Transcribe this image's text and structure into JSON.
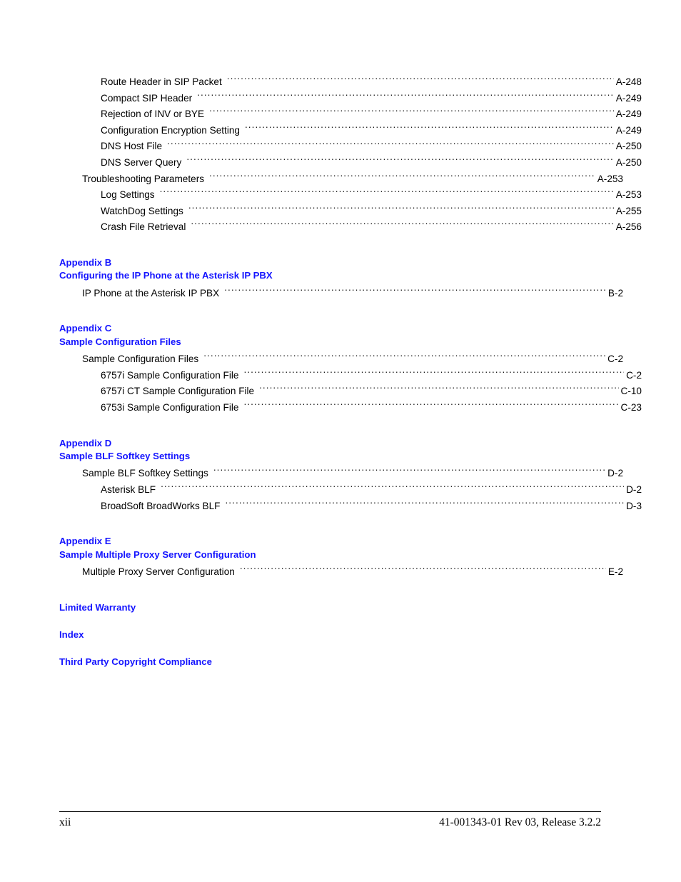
{
  "document": {
    "type": "table-of-contents",
    "heading_color": "#1414ff",
    "text_color": "#000000"
  },
  "toc": {
    "top_entries": [
      {
        "title": "Route Header in SIP Packet",
        "page": "A-248",
        "level": 2
      },
      {
        "title": "Compact SIP Header",
        "page": "A-249",
        "level": 2
      },
      {
        "title": "Rejection of INV or BYE",
        "page": "A-249",
        "level": 2
      },
      {
        "title": "Configuration Encryption Setting",
        "page": "A-249",
        "level": 2
      },
      {
        "title": "DNS Host File",
        "page": "A-250",
        "level": 2
      },
      {
        "title": "DNS Server Query",
        "page": "A-250",
        "level": 2
      },
      {
        "title": "Troubleshooting Parameters",
        "page": "A-253",
        "level": 1
      },
      {
        "title": "Log Settings",
        "page": "A-253",
        "level": 2
      },
      {
        "title": "WatchDog Settings",
        "page": "A-255",
        "level": 2
      },
      {
        "title": "Crash File Retrieval",
        "page": "A-256",
        "level": 2
      }
    ],
    "appendices": [
      {
        "label": "Appendix B",
        "title": "Configuring the IP Phone at the Asterisk IP PBX",
        "entries": [
          {
            "title": "IP Phone at the Asterisk IP PBX",
            "page": "B-2",
            "level": 1
          }
        ]
      },
      {
        "label": "Appendix C",
        "title": "Sample Configuration Files",
        "entries": [
          {
            "title": "Sample Configuration Files",
            "page": "C-2",
            "level": 1
          },
          {
            "title": "6757i Sample Configuration File",
            "page": "C-2",
            "level": 2
          },
          {
            "title": "6757i CT Sample Configuration File",
            "page": "C-10",
            "level": 2
          },
          {
            "title": "6753i Sample Configuration File",
            "page": "C-23",
            "level": 2
          }
        ]
      },
      {
        "label": "Appendix D",
        "title": "Sample BLF Softkey Settings",
        "entries": [
          {
            "title": "Sample BLF Softkey Settings",
            "page": "D-2",
            "level": 1
          },
          {
            "title": "Asterisk BLF",
            "page": "D-2",
            "level": 2
          },
          {
            "title": "BroadSoft BroadWorks BLF",
            "page": "D-3",
            "level": 2
          }
        ]
      },
      {
        "label": "Appendix E",
        "title": "Sample Multiple Proxy Server Configuration",
        "entries": [
          {
            "title": "Multiple Proxy Server Configuration",
            "page": "E-2",
            "level": 1
          }
        ]
      }
    ],
    "back_matter": [
      {
        "title": "Limited Warranty"
      },
      {
        "title": "Index"
      },
      {
        "title": "Third Party Copyright Compliance"
      }
    ]
  },
  "footer": {
    "page_number": "xii",
    "document_id": "41-001343-01 Rev 03, Release 3.2.2"
  }
}
